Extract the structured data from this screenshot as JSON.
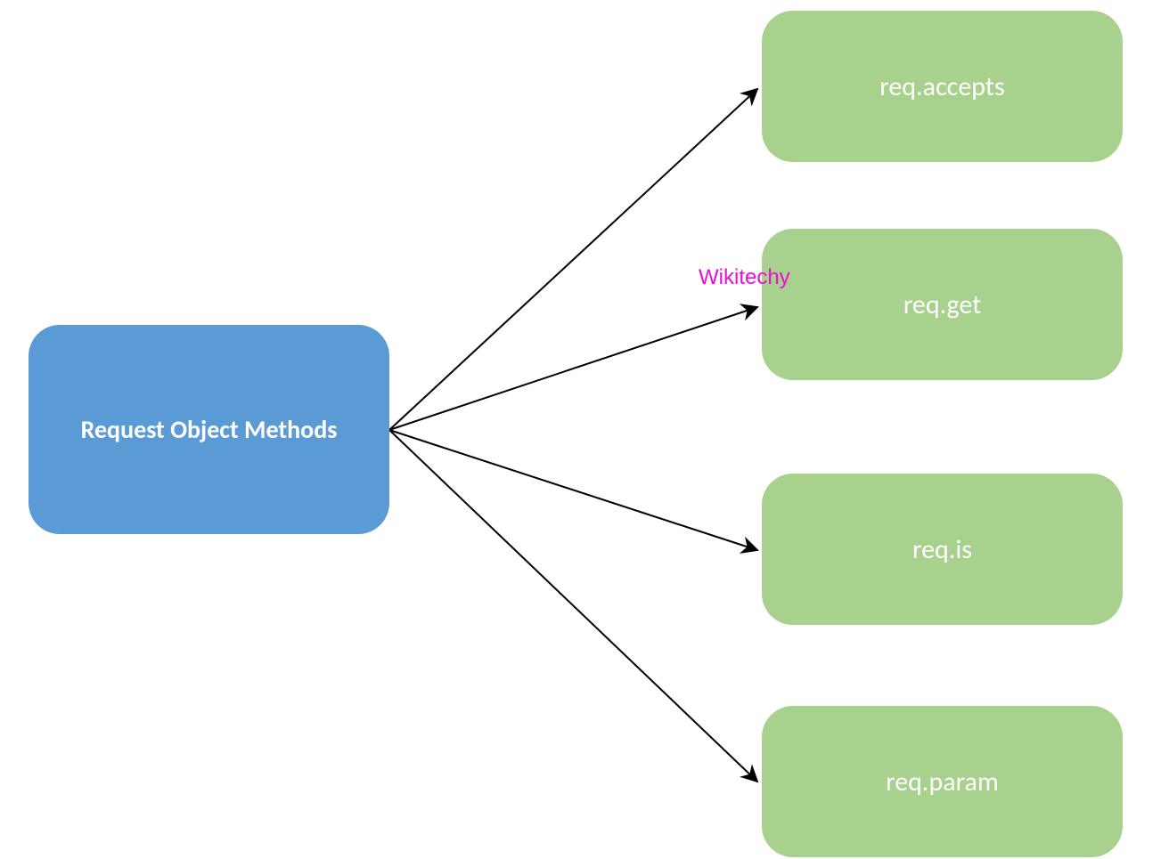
{
  "diagram": {
    "source": {
      "label": "Request Object Methods"
    },
    "targets": [
      {
        "label": "req.accepts"
      },
      {
        "label": "req.get"
      },
      {
        "label": "req.is"
      },
      {
        "label": "req.param"
      }
    ],
    "watermark": "Wikitechy",
    "colors": {
      "source_bg": "#5B9BD5",
      "target_bg": "#A9D18E",
      "text": "#ffffff",
      "watermark": "#ED0CD7",
      "arrow": "#000000"
    }
  }
}
